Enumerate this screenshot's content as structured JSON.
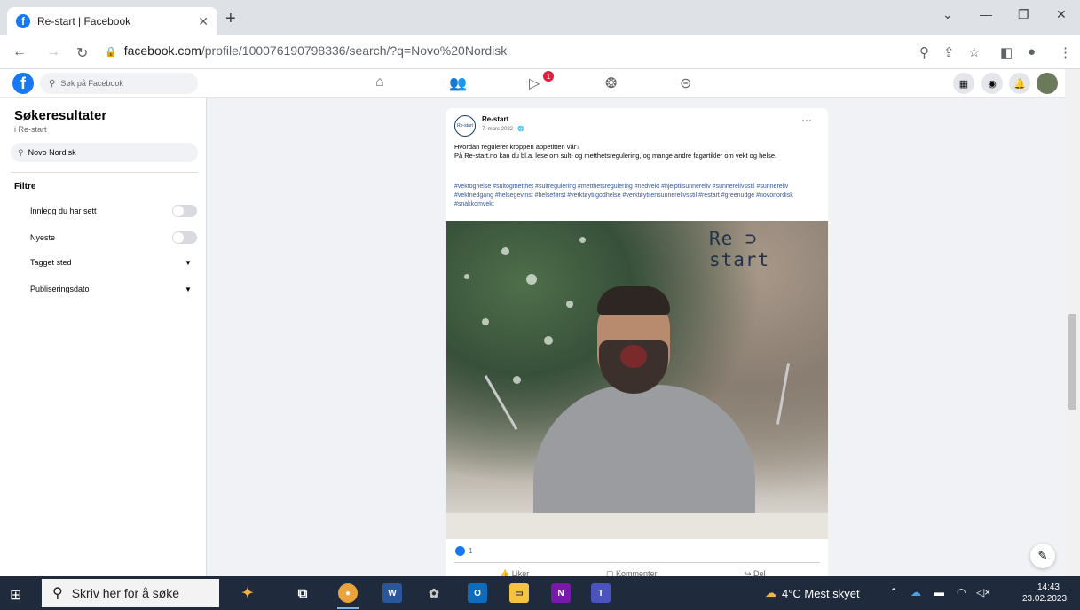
{
  "browser": {
    "tab_title": "Re-start | Facebook",
    "url_host": "facebook.com",
    "url_path": "/profile/100076190798336/search/?q=Novo%20Nordisk"
  },
  "facebook": {
    "search_placeholder": "Søk på Facebook",
    "notification_count": "1"
  },
  "sidebar": {
    "title": "Søkeresultater",
    "subtitle": "i Re-start",
    "search_value": "Novo Nordisk",
    "filters_label": "Filtre",
    "filters": [
      {
        "label": "Innlegg du har sett",
        "type": "toggle"
      },
      {
        "label": "Nyeste",
        "type": "toggle"
      },
      {
        "label": "Tagget sted",
        "type": "dropdown"
      },
      {
        "label": "Publiseringsdato",
        "type": "dropdown"
      }
    ]
  },
  "post": {
    "author": "Re-start",
    "date": "7. mars 2022 · 🌐",
    "text_line1": "Hvordan regulerer kroppen appetitten vår?",
    "text_line2": "På Re-start.no kan du bl.a. lese om sult- og metthetsregulering, og mange andre fagartikler om vekt og helse.",
    "hashtags": "#vektoghelse #sultogmetthet #sultregulering #metthetsregulering #nedvekt #hjelptilsunnereliv #sunnerelivsstil #sunnereliv #vektnedgang #helsegevinst #helseførst #verktøytilgodhelse #verktøytilensunnerelivsstil #restart #greenudge #novonordisk #snakkomvekt",
    "image_logo": "Re ⊃ start",
    "reaction_count": "1",
    "actions": {
      "like": "Liker",
      "comment": "Kommenter",
      "share": "Del"
    }
  },
  "taskbar": {
    "search_placeholder": "Skriv her for å søke",
    "weather": "4°C  Mest skyet",
    "time": "14:43",
    "date": "23.02.2023"
  },
  "icons": {
    "home": "home-icon",
    "friends": "friends-icon",
    "watch": "watch-icon",
    "groups": "groups-icon",
    "gaming": "gaming-icon"
  }
}
